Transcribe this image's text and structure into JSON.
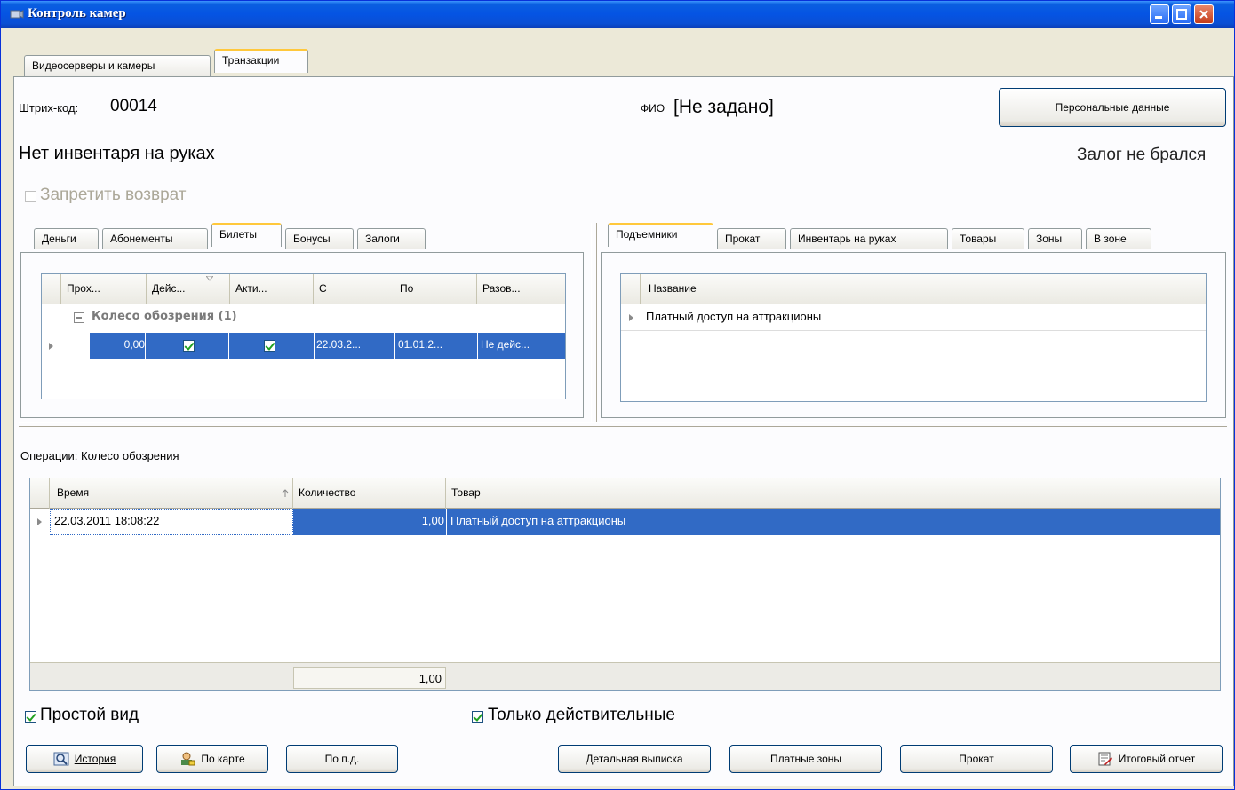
{
  "window": {
    "title": "Контроль камер"
  },
  "main_tabs": [
    "Видеосерверы и камеры",
    "Транзакции"
  ],
  "header": {
    "barcode_label": "Штрих-код:",
    "barcode_value": "00014",
    "fio_label": "ФИО",
    "fio_value": "[Не задано]",
    "personal_data_button": "Персональные данные",
    "inventory_status": "Нет инвентаря на руках",
    "deposit_status": "Залог не брался",
    "forbid_return_label": "Запретить возврат"
  },
  "left_tabs": [
    "Деньги",
    "Абонементы",
    "Билеты",
    "Бонусы",
    "Залоги"
  ],
  "left_grid": {
    "columns": [
      "Прох...",
      "Дейс...",
      "Акти...",
      "С",
      "По",
      "Разов..."
    ],
    "group_label": "Колесо обозрения (1)",
    "row": {
      "passes": "0,00",
      "active1": true,
      "active2": true,
      "from": "22.03.2...",
      "to": "01.01.2...",
      "single": "Не дейс..."
    }
  },
  "right_tabs": [
    "Подъемники",
    "Прокат",
    "Инвентарь на руках",
    "Товары",
    "Зоны",
    "В зоне"
  ],
  "right_grid": {
    "columns": [
      "Название"
    ],
    "rows": [
      "Платный доступ на аттракционы"
    ]
  },
  "operations": {
    "title": "Операции: Колесо обозрения",
    "columns": [
      "Время",
      "Количество",
      "Товар"
    ],
    "rows": [
      {
        "time": "22.03.2011 18:08:22",
        "qty": "1,00",
        "item": "Платный доступ на аттракционы"
      }
    ],
    "total": "1,00"
  },
  "options": {
    "simple_view": "Простой вид",
    "only_valid": "Только действительные"
  },
  "buttons": {
    "history": "История",
    "by_card": "По карте",
    "by_pd": "По п.д.",
    "detailed": "Детальная выписка",
    "paid_zones": "Платные зоны",
    "rental": "Прокат",
    "final_report": "Итоговый отчет"
  }
}
